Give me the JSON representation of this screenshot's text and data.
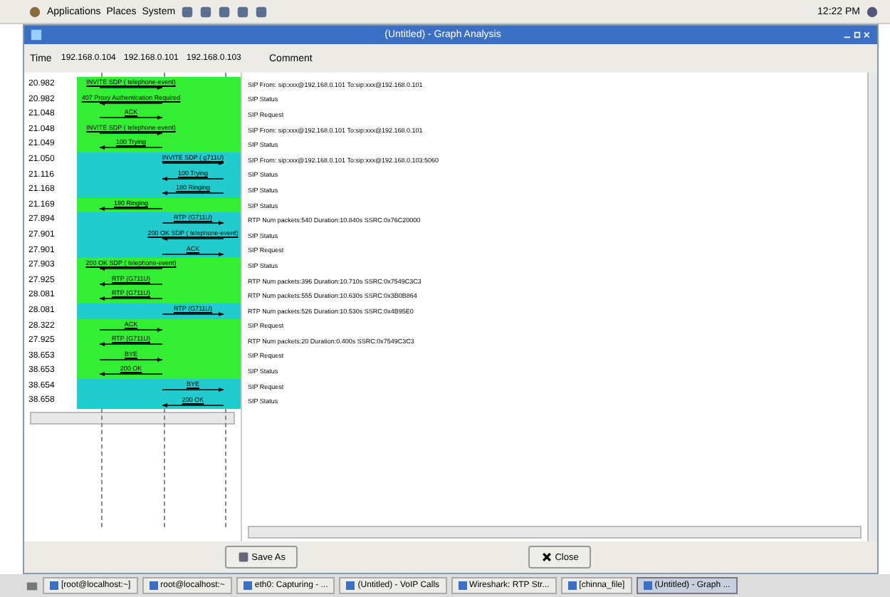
{
  "top_panel": {
    "menus": [
      "Applications",
      "Places",
      "System"
    ],
    "clock": "12:22 PM"
  },
  "window": {
    "title": "(Untitled) - Graph Analysis"
  },
  "header": {
    "time": "Time",
    "hosts": [
      "192.168.0.104",
      "192.168.0.101",
      "192.168.0.103"
    ],
    "comment": "Comment"
  },
  "rows": [
    {
      "time": "20.982",
      "color": "#33ee33",
      "kind": "ab",
      "label": "INVITE SDP ( telephone-event)",
      "comment": "SIP From: sip:xxx@192.168.0.101 To:sip:xxx@192.168.0.101"
    },
    {
      "time": "20.982",
      "color": "#33ee33",
      "kind": "ba",
      "label": "407 Proxy Authentication Required",
      "comment": "SIP Status"
    },
    {
      "time": "21.048",
      "color": "#33ee33",
      "kind": "ab",
      "label": "ACK",
      "comment": "SIP Request"
    },
    {
      "time": "21.048",
      "color": "#33ee33",
      "kind": "ab",
      "label": "INVITE SDP ( telephone-event)",
      "comment": "SIP From: sip:xxx@192.168.0.101 To:sip:xxx@192.168.0.101"
    },
    {
      "time": "21.049",
      "color": "#33ee33",
      "kind": "ba",
      "label": "100 Trying",
      "comment": "SIP Status"
    },
    {
      "time": "21.050",
      "color": "#22cccc",
      "kind": "bc",
      "label": "INVITE SDP ( g711U)",
      "comment": "SIP From: sip:xxx@192.168.0.101 To:sip:xxx@192.168.0.103:5060"
    },
    {
      "time": "21.116",
      "color": "#22cccc",
      "kind": "cb",
      "label": "100 Trying",
      "comment": "SIP Status"
    },
    {
      "time": "21.168",
      "color": "#22cccc",
      "kind": "cb",
      "label": "180 Ringing",
      "comment": "SIP Status"
    },
    {
      "time": "21.169",
      "color": "#33ee33",
      "kind": "ba",
      "label": "180 Ringing",
      "comment": "SIP Status"
    },
    {
      "time": "27.894",
      "color": "#22cccc",
      "kind": "bc",
      "label": "RTP (G711U)",
      "comment": "RTP Num packets:540 Duration:10.840s SSRC:0x76C20000"
    },
    {
      "time": "27.901",
      "color": "#22cccc",
      "kind": "cb",
      "label": "200 OK SDP ( telephone-event)",
      "comment": "SIP Status"
    },
    {
      "time": "27.901",
      "color": "#22cccc",
      "kind": "bc",
      "label": "ACK",
      "comment": "SIP Request"
    },
    {
      "time": "27.903",
      "color": "#33ee33",
      "kind": "ba",
      "label": "200 OK SDP ( telephone-event)",
      "comment": "SIP Status"
    },
    {
      "time": "27.925",
      "color": "#33ee33",
      "kind": "ba",
      "label": "RTP (G711U)",
      "comment": "RTP Num packets:396 Duration:10.710s SSRC:0x7549C3C3"
    },
    {
      "time": "28.081",
      "color": "#33ee33",
      "kind": "ba",
      "label": "RTP (G711U)",
      "comment": "RTP Num packets:555 Duration:10.630s SSRC:0x3B0B864"
    },
    {
      "time": "28.081",
      "color": "#22cccc",
      "kind": "bc",
      "label": "RTP (G711U)",
      "comment": "RTP Num packets:526 Duration:10.530s SSRC:0x4B95E0"
    },
    {
      "time": "28.322",
      "color": "#33ee33",
      "kind": "ab",
      "label": "ACK",
      "comment": "SIP Request"
    },
    {
      "time": "27.925",
      "color": "#33ee33",
      "kind": "ba",
      "label": "RTP (G711U)",
      "comment": "RTP Num packets:20 Duration:0.400s SSRC:0x7549C3C3"
    },
    {
      "time": "38.653",
      "color": "#33ee33",
      "kind": "ab",
      "label": "BYE",
      "comment": "SIP Request"
    },
    {
      "time": "38.653",
      "color": "#33ee33",
      "kind": "ba",
      "label": "200 OK",
      "comment": "SIP Status"
    },
    {
      "time": "38.654",
      "color": "#22cccc",
      "kind": "bc",
      "label": "BYE",
      "comment": "SIP Request"
    },
    {
      "time": "38.658",
      "color": "#22cccc",
      "kind": "cb",
      "label": "200 OK",
      "comment": "SIP Status"
    }
  ],
  "buttons": [
    "Save As",
    "Close"
  ],
  "taskbar": [
    {
      "label": "[root@localhost:~]",
      "selected": false
    },
    {
      "label": "root@localhost:~",
      "selected": false
    },
    {
      "label": "eth0: Capturing - ...",
      "selected": false
    },
    {
      "label": "(Untitled) - VoIP Calls",
      "selected": false
    },
    {
      "label": "Wireshark: RTP Str...",
      "selected": false
    },
    {
      "label": "[chinna_file]",
      "selected": false
    },
    {
      "label": "(Untitled) - Graph ...",
      "selected": true
    }
  ]
}
